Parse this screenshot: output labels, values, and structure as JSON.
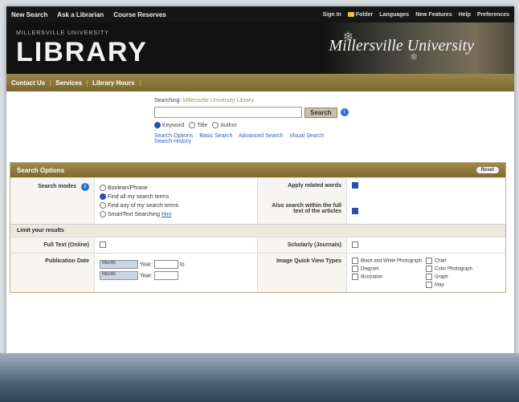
{
  "topnav": {
    "left": [
      "New Search",
      "Ask a Librarian",
      "Course Reserves"
    ],
    "right": [
      "Sign In",
      "Folder",
      "Languages",
      "New Features",
      "Help",
      "Preferences"
    ]
  },
  "banner": {
    "university": "MILLERSVILLE UNIVERSITY",
    "title": "LIBRARY",
    "script": "Millersville University"
  },
  "goldnav": [
    "Contact Us",
    "Services",
    "Library Hours"
  ],
  "search": {
    "searching_prefix": "Searching:",
    "searching_target": "Millersville University Library",
    "button": "Search",
    "radios": [
      "Keyword",
      "Title",
      "Author"
    ],
    "links": [
      "Search Options",
      "Basic Search",
      "Advanced Search",
      "Visual Search",
      "Search History"
    ]
  },
  "options": {
    "header": "Search Options",
    "reset": "Reset",
    "search_modes_label": "Search modes",
    "modes": [
      "Boolean/Phrase",
      "Find all my search terms",
      "Find any of my search terms",
      "SmartText Searching"
    ],
    "more": "Hint",
    "apply_related": "Apply related words",
    "fulltext_search": "Also search within the full text of the articles",
    "limit_header": "Limit your results",
    "full_text": "Full Text (Online)",
    "scholarly": "Scholarly (Journals)",
    "pub_date": "Publication Date",
    "month": "Month",
    "year": "Year:",
    "to": "to",
    "image_types_label": "Image Quick View Types",
    "image_types": [
      "Black and White Photograph",
      "Chart",
      "Diagram",
      "Color Photograph",
      "Illustration",
      "Graph",
      "Map"
    ]
  }
}
